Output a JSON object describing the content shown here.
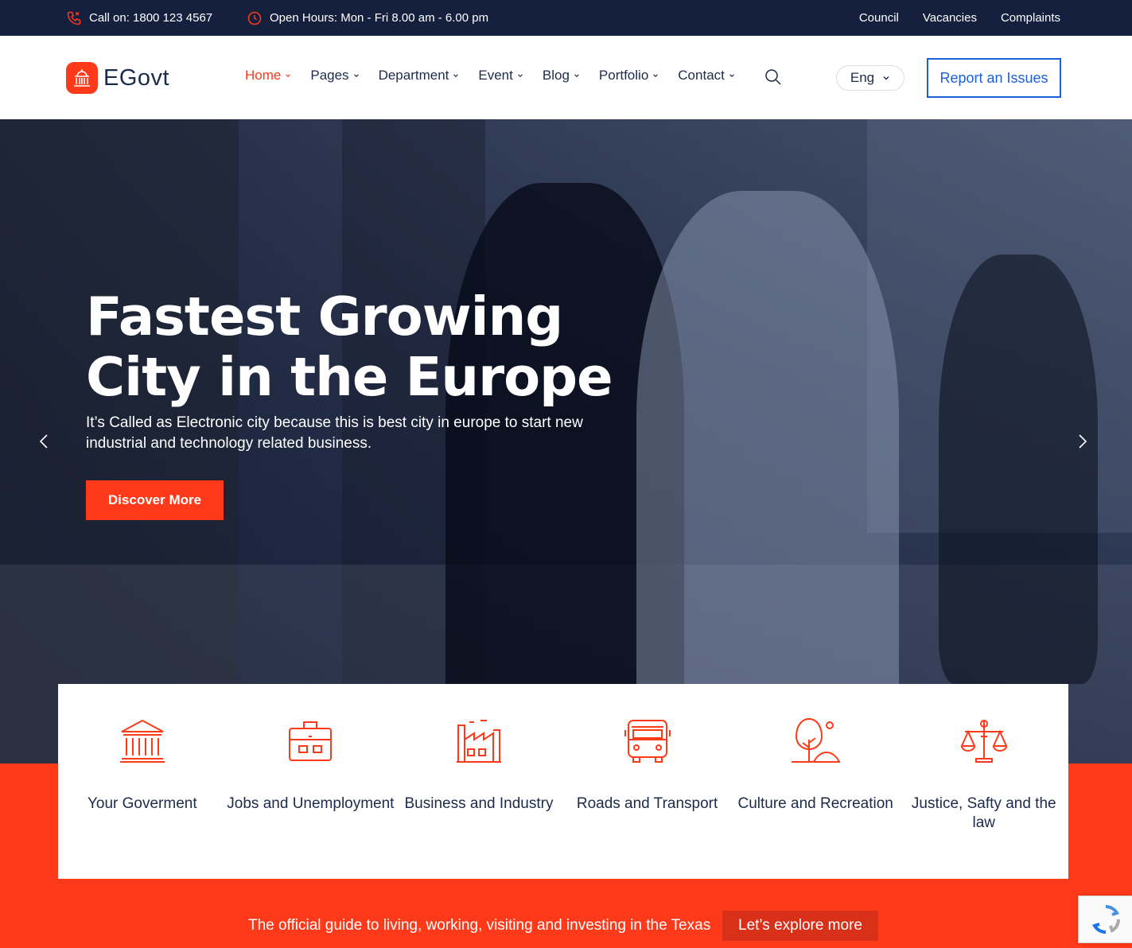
{
  "topbar": {
    "phone": "Call on: 1800 123 4567",
    "hours": "Open Hours: Mon - Fri 8.00 am - 6.00 pm",
    "links": [
      "Council",
      "Vacancies",
      "Complaints"
    ]
  },
  "header": {
    "logo": "EGovt",
    "nav": [
      {
        "label": "Home",
        "active": true
      },
      {
        "label": "Pages",
        "active": false
      },
      {
        "label": "Department",
        "active": false
      },
      {
        "label": "Event",
        "active": false
      },
      {
        "label": "Blog",
        "active": false
      },
      {
        "label": "Portfolio",
        "active": false
      },
      {
        "label": "Contact",
        "active": false
      }
    ],
    "language": "Eng",
    "report_button": "Report an Issues"
  },
  "hero": {
    "title": "Fastest Growing City in the Europe",
    "subtitle": "It’s Called as Electronic city because this is best city in europe to start new industrial and technology related business.",
    "cta": "Discover More"
  },
  "services": [
    {
      "label": "Your Goverment",
      "icon": "government-building-icon"
    },
    {
      "label": "Jobs and Unemployment",
      "icon": "briefcase-icon"
    },
    {
      "label": "Business and Industry",
      "icon": "factory-icon"
    },
    {
      "label": "Roads and Transport",
      "icon": "bus-icon"
    },
    {
      "label": "Culture and Recreation",
      "icon": "tree-park-icon"
    },
    {
      "label": "Justice, Safty and the law",
      "icon": "scales-icon"
    }
  ],
  "guide": {
    "text": "The official guide to living, working, visiting and investing in the Texas",
    "button": "Let’s explore more"
  },
  "colors": {
    "accent": "#ff3a1a",
    "navy": "#14203d",
    "link_blue": "#1d5fd6",
    "text": "#1c2b4a"
  }
}
